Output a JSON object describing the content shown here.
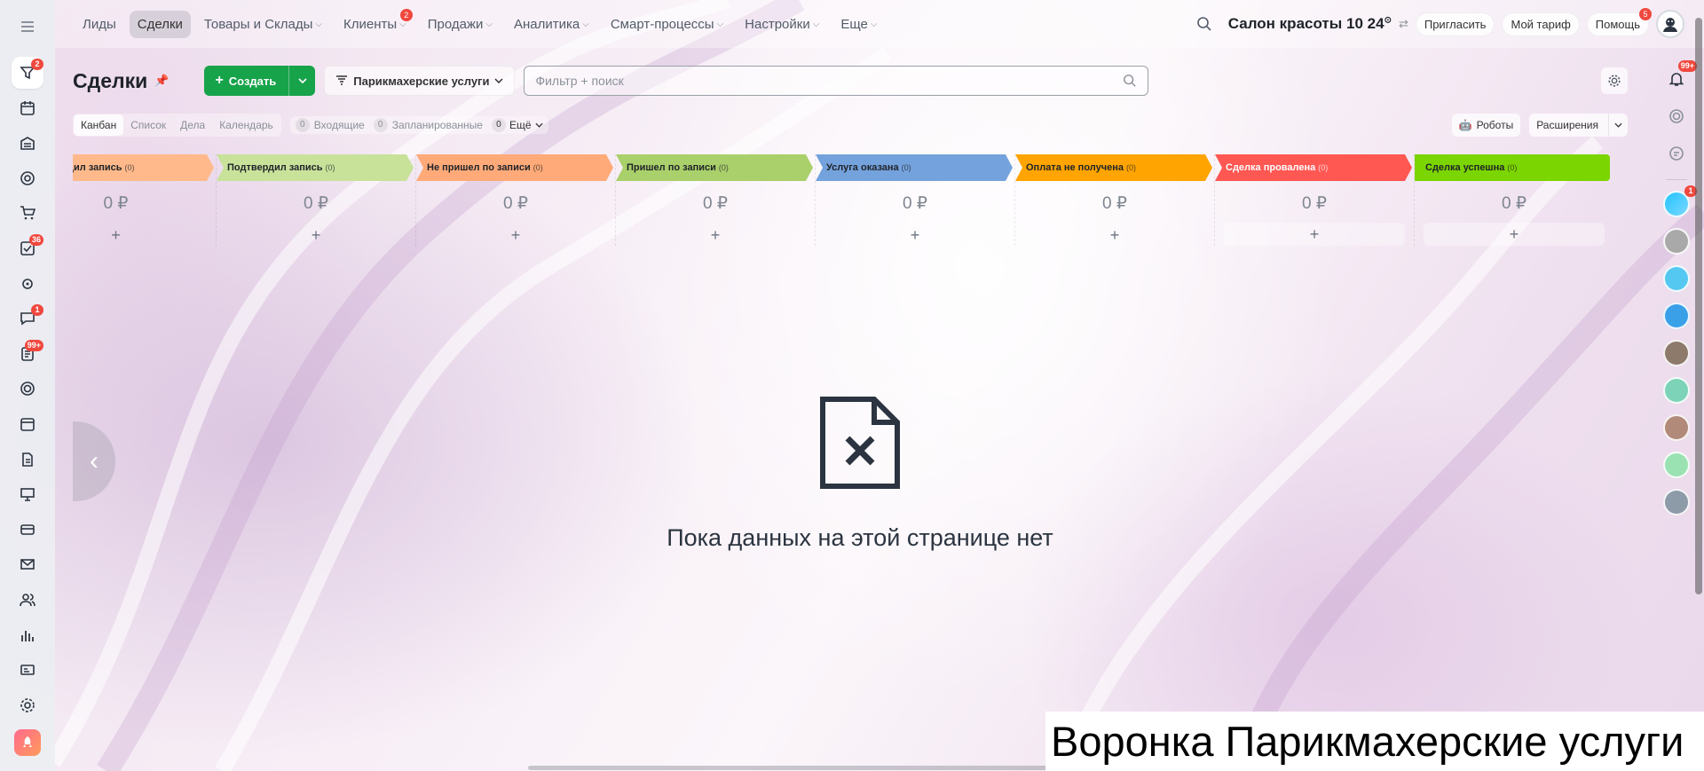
{
  "top_nav": [
    {
      "label": "Лиды",
      "chevron": false,
      "active": false,
      "badge": ""
    },
    {
      "label": "Сделки",
      "chevron": false,
      "active": true,
      "badge": ""
    },
    {
      "label": "Товары и Склады",
      "chevron": true,
      "active": false,
      "badge": ""
    },
    {
      "label": "Клиенты",
      "chevron": true,
      "active": false,
      "badge": "2"
    },
    {
      "label": "Продажи",
      "chevron": true,
      "active": false,
      "badge": ""
    },
    {
      "label": "Аналитика",
      "chevron": true,
      "active": false,
      "badge": ""
    },
    {
      "label": "Смарт-процессы",
      "chevron": true,
      "active": false,
      "badge": ""
    },
    {
      "label": "Настройки",
      "chevron": true,
      "active": false,
      "badge": ""
    },
    {
      "label": "Еще",
      "chevron": true,
      "active": false,
      "badge": ""
    }
  ],
  "header": {
    "company": "Салон красоты",
    "time": "10 24",
    "invite_label": "Пригласить",
    "tariff_label": "Мой тариф",
    "help_label": "Помощь",
    "help_badge": "5"
  },
  "left_bar": [
    {
      "icon": "menu-icon",
      "badge": ""
    },
    {
      "icon": "crm-funnel-icon",
      "badge": "2",
      "active": true
    },
    {
      "icon": "calendar-grid-icon",
      "badge": ""
    },
    {
      "icon": "warehouse-icon",
      "badge": ""
    },
    {
      "icon": "target-icon",
      "badge": ""
    },
    {
      "icon": "cart-icon",
      "badge": ""
    },
    {
      "icon": "tasks-icon",
      "badge": "36"
    },
    {
      "icon": "automation-icon",
      "badge": ""
    },
    {
      "icon": "chat-icon",
      "badge": "1"
    },
    {
      "icon": "feed-icon",
      "badge": "99+"
    },
    {
      "icon": "support-icon",
      "badge": ""
    },
    {
      "icon": "calendar-icon",
      "badge": ""
    },
    {
      "icon": "document-icon",
      "badge": ""
    },
    {
      "icon": "presentation-icon",
      "badge": ""
    },
    {
      "icon": "terminal-icon",
      "badge": ""
    },
    {
      "icon": "mail-icon",
      "badge": ""
    },
    {
      "icon": "contacts-icon",
      "badge": ""
    },
    {
      "icon": "analytics-icon",
      "badge": ""
    },
    {
      "icon": "id-card-icon",
      "badge": ""
    },
    {
      "icon": "settings-icon",
      "badge": ""
    },
    {
      "icon": "rocket-icon",
      "badge": ""
    }
  ],
  "page": {
    "title": "Сделки",
    "create_label": "Создать",
    "funnel_label": "Парикмахерские услуги",
    "search_placeholder": "Фильтр + поиск"
  },
  "views": [
    {
      "label": "Канбан",
      "active": true
    },
    {
      "label": "Список",
      "active": false
    },
    {
      "label": "Дела",
      "active": false
    },
    {
      "label": "Календарь",
      "active": false
    }
  ],
  "counters": [
    {
      "count": "0",
      "label": "Входящие"
    },
    {
      "count": "0",
      "label": "Запланированные"
    },
    {
      "count": "0",
      "label": "Ещё"
    }
  ],
  "robots_label": "Роботы",
  "extensions_label": "Расширения",
  "columns": [
    {
      "name": "Подтвердил запись",
      "count": "(0)",
      "sum": "0 ₽",
      "color": "#ffb98a",
      "light": false,
      "shaded": false
    },
    {
      "name": "Подтвердил запись",
      "count": "(0)",
      "sum": "0 ₽",
      "color": "#c8e29a",
      "light": false,
      "shaded": false
    },
    {
      "name": "Не пришел по записи",
      "count": "(0)",
      "sum": "0 ₽",
      "color": "#ffaa78",
      "light": false,
      "shaded": false
    },
    {
      "name": "Пришел по записи",
      "count": "(0)",
      "sum": "0 ₽",
      "color": "#a9d06a",
      "light": false,
      "shaded": false
    },
    {
      "name": "Услуга оказана",
      "count": "(0)",
      "sum": "0 ₽",
      "color": "#74a2dc",
      "light": false,
      "shaded": false
    },
    {
      "name": "Оплата не получена",
      "count": "(0)",
      "sum": "0 ₽",
      "color": "#ffa400",
      "light": false,
      "shaded": false
    },
    {
      "name": "Сделка провалена",
      "count": "(0)",
      "sum": "0 ₽",
      "color": "#ff5752",
      "light": true,
      "shaded": true
    },
    {
      "name": "Сделка успешна",
      "count": "(0)",
      "sum": "0 ₽",
      "color": "#7bd500",
      "light": false,
      "shaded": true
    }
  ],
  "add_symbol": "+",
  "empty_text": "Пока данных на этой странице нет",
  "right_bar": {
    "notifications_badge": "99+",
    "chat_badge": "1"
  },
  "caption": "Воронка Парикмахерские услуги"
}
